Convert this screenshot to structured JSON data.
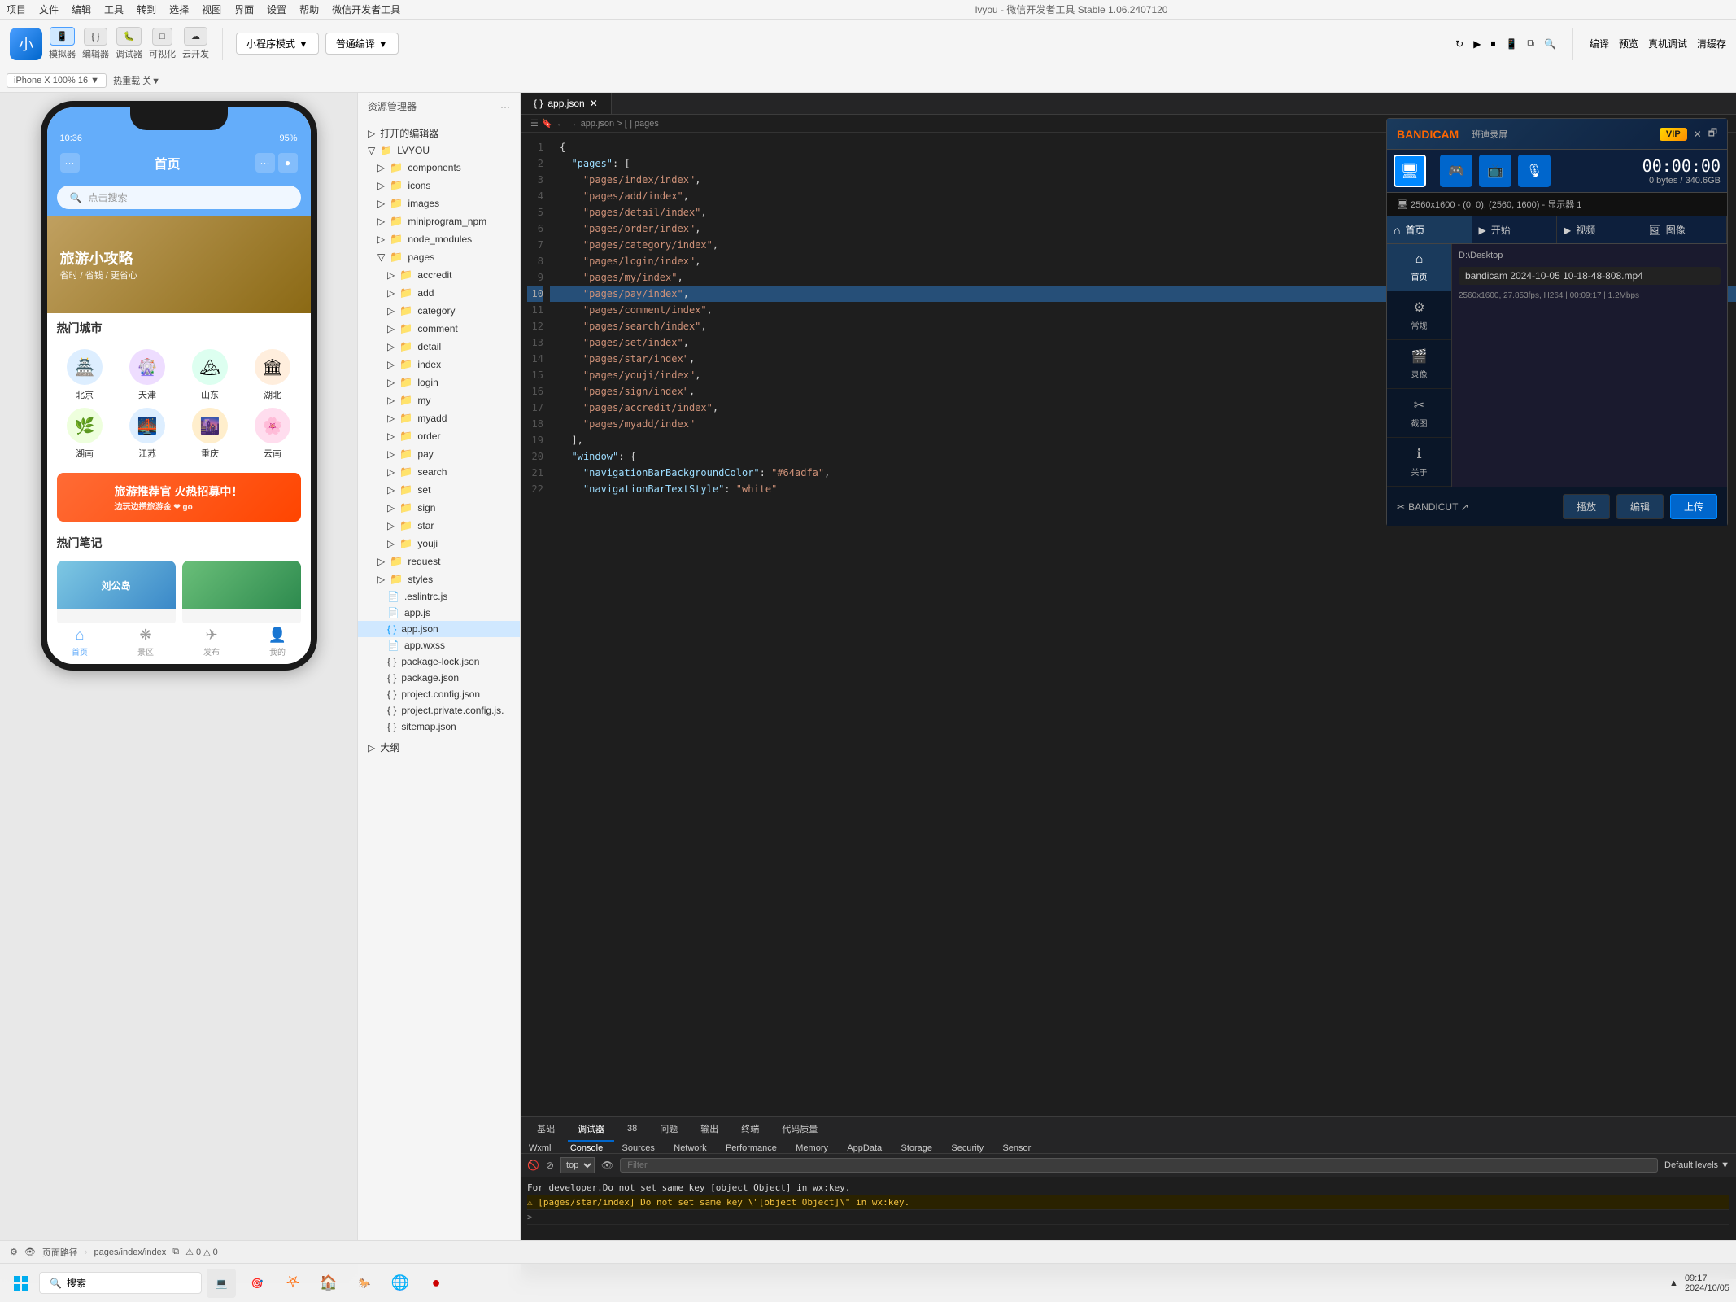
{
  "app": {
    "title": "lvyou - 微信开发者工具 Stable 1.06.2407120"
  },
  "menu": {
    "items": [
      "项目",
      "文件",
      "编辑",
      "工具",
      "转到",
      "选择",
      "视图",
      "界面",
      "设置",
      "帮助",
      "微信开发者工具"
    ]
  },
  "toolbar": {
    "simulator_label": "模拟器",
    "editor_label": "编辑器",
    "debugger_label": "调试器",
    "visual_label": "可视化",
    "cloud_label": "云开发",
    "mode_label": "小程序模式",
    "compile_label": "普通编译",
    "translate_label": "编译",
    "preview_label": "预览",
    "real_label": "真机调试",
    "clear_label": "清缓存"
  },
  "secondary_toolbar": {
    "device": "iPhone X 100% 16 ▼",
    "reload": "热重载 关▼"
  },
  "phone": {
    "time": "10:36",
    "battery": "95%",
    "nav_title": "首页",
    "search_placeholder": "点击搜索",
    "banner_title": "旅游小攻略",
    "banner_subtitle": "省时 / 省钱 / 更省心",
    "hot_cities_title": "热门城市",
    "cities": [
      {
        "name": "北京",
        "icon": "🏯"
      },
      {
        "name": "天津",
        "icon": "🎡"
      },
      {
        "name": "山东",
        "icon": "🏔"
      },
      {
        "name": "湖北",
        "icon": "🏛"
      },
      {
        "name": "湖南",
        "icon": "🌿"
      },
      {
        "name": "江苏",
        "icon": "🌉"
      },
      {
        "name": "重庆",
        "icon": "🌆"
      },
      {
        "name": "云南",
        "icon": "🌸"
      }
    ],
    "promo_text": "旅游推荐官 火热招募中！",
    "promo_sub": "边玩边攒旅游金 ❤ go",
    "notes_title": "热门笔记",
    "notes": [
      {
        "title": "刘公岛",
        "color": "#5ba4d4"
      },
      {
        "title": "",
        "color": "#2d8a4e"
      }
    ],
    "bottom_nav": [
      {
        "label": "首页",
        "icon": "⌂",
        "active": true
      },
      {
        "label": "景区",
        "icon": "❋",
        "active": false
      },
      {
        "label": "发布",
        "icon": "✈",
        "active": false
      },
      {
        "label": "我的",
        "icon": "👤",
        "active": false
      }
    ]
  },
  "file_explorer": {
    "title": "资源管理器",
    "section_open_editors": "打开的编辑器",
    "project_name": "LVYOU",
    "folders": [
      {
        "name": "components",
        "indent": 1
      },
      {
        "name": "icons",
        "indent": 1
      },
      {
        "name": "images",
        "indent": 1
      },
      {
        "name": "miniprogram_npm",
        "indent": 1
      },
      {
        "name": "node_modules",
        "indent": 1
      },
      {
        "name": "pages",
        "indent": 1
      },
      {
        "name": "accredit",
        "indent": 2
      },
      {
        "name": "add",
        "indent": 2
      },
      {
        "name": "category",
        "indent": 2
      },
      {
        "name": "comment",
        "indent": 2
      },
      {
        "name": "detail",
        "indent": 2
      },
      {
        "name": "index",
        "indent": 2
      },
      {
        "name": "login",
        "indent": 2
      },
      {
        "name": "my",
        "indent": 2
      },
      {
        "name": "myadd",
        "indent": 2
      },
      {
        "name": "order",
        "indent": 2
      },
      {
        "name": "pay",
        "indent": 2
      },
      {
        "name": "search",
        "indent": 2
      },
      {
        "name": "set",
        "indent": 2
      },
      {
        "name": "sign",
        "indent": 2
      },
      {
        "name": "star",
        "indent": 2
      },
      {
        "name": "youji",
        "indent": 2
      },
      {
        "name": "request",
        "indent": 1
      },
      {
        "name": "styles",
        "indent": 1
      }
    ],
    "files": [
      {
        "name": ".eslintrc.js",
        "indent": 2
      },
      {
        "name": "app.js",
        "indent": 2
      },
      {
        "name": "app.json",
        "indent": 2,
        "active": true
      },
      {
        "name": "app.wxss",
        "indent": 2
      },
      {
        "name": "package-lock.json",
        "indent": 2
      },
      {
        "name": "package.json",
        "indent": 2
      },
      {
        "name": "project.config.json",
        "indent": 2
      },
      {
        "name": "project.private.config.js",
        "indent": 2
      },
      {
        "name": "sitemap.json",
        "indent": 2
      }
    ],
    "outline_label": "大纲"
  },
  "code_editor": {
    "tab_name": "app.json",
    "breadcrumb": "app.json > [ ] pages",
    "lines": [
      {
        "num": 1,
        "code": "{",
        "type": "normal"
      },
      {
        "num": 2,
        "code": "  \"pages\": [",
        "type": "normal"
      },
      {
        "num": 3,
        "code": "    \"pages/index/index\",",
        "type": "normal"
      },
      {
        "num": 4,
        "code": "    \"pages/add/index\",",
        "type": "normal"
      },
      {
        "num": 5,
        "code": "    \"pages/detail/index\",",
        "type": "normal"
      },
      {
        "num": 6,
        "code": "    \"pages/order/index\",",
        "type": "normal"
      },
      {
        "num": 7,
        "code": "    \"pages/category/index\",",
        "type": "normal"
      },
      {
        "num": 8,
        "code": "    \"pages/login/index\",",
        "type": "normal"
      },
      {
        "num": 9,
        "code": "    \"pages/my/index\",",
        "type": "normal"
      },
      {
        "num": 10,
        "code": "    \"pages/pay/index\",",
        "type": "highlighted"
      },
      {
        "num": 11,
        "code": "    \"pages/comment/index\",",
        "type": "normal"
      },
      {
        "num": 12,
        "code": "    \"pages/search/index\",",
        "type": "normal"
      },
      {
        "num": 13,
        "code": "    \"pages/set/index\",",
        "type": "normal"
      },
      {
        "num": 14,
        "code": "    \"pages/star/index\",",
        "type": "normal"
      },
      {
        "num": 15,
        "code": "    \"pages/youji/index\",",
        "type": "normal"
      },
      {
        "num": 16,
        "code": "    \"pages/sign/index\",",
        "type": "normal"
      },
      {
        "num": 17,
        "code": "    \"pages/accredit/index\",",
        "type": "normal"
      },
      {
        "num": 18,
        "code": "    \"pages/myadd/index\"",
        "type": "normal"
      },
      {
        "num": 19,
        "code": "  ],",
        "type": "normal"
      },
      {
        "num": 20,
        "code": "  \"window\": {",
        "type": "normal"
      },
      {
        "num": 21,
        "code": "    \"navigationBarBackgroundColor\": \"#64adfa\",",
        "type": "normal"
      },
      {
        "num": 22,
        "code": "    \"navigationBarTextStyle\": \"white\"",
        "type": "normal"
      }
    ]
  },
  "devtools": {
    "tabs": [
      "基础",
      "调试器",
      "38",
      "问题",
      "输出",
      "终端",
      "代码质量"
    ],
    "active_tab": "调试器",
    "sub_tabs": [
      "Wxml",
      "Console",
      "Sources",
      "Network",
      "Performance",
      "Memory",
      "AppData",
      "Storage",
      "Security",
      "Sensor"
    ],
    "active_sub_tab": "Console",
    "context": "top",
    "filter_placeholder": "Filter",
    "level": "Default levels ▼",
    "console_lines": [
      {
        "type": "normal",
        "text": "For developer.Do not set same key [object Object] in wx:key."
      },
      {
        "type": "warn",
        "text": "[pages/star/index] Do not set same key \\\"[object Object]\\\" in wx:key."
      },
      {
        "type": "prompt",
        "text": ">"
      }
    ]
  },
  "bandicam": {
    "logo": "BANDICAM",
    "subtitle": "班迪录屏",
    "vip_label": "VIP",
    "time": "00:00:00",
    "size": "0 bytes / 340.6GB",
    "resolution": "2560x1600 - (0, 0), (2560, 1600) - 显示器 1",
    "nav": [
      {
        "icon": "🖥",
        "label": "首页",
        "active": true
      },
      {
        "icon": "▶",
        "label": "视频",
        "active": false
      },
      {
        "icon": "🖼",
        "label": "图像",
        "active": false
      }
    ],
    "sidebar": [
      {
        "icon": "⌂",
        "label": "首页",
        "active": true
      },
      {
        "icon": "⚙",
        "label": "常规",
        "active": false
      },
      {
        "icon": "🎬",
        "label": "录像",
        "active": false
      },
      {
        "icon": "✂",
        "label": "截图",
        "active": false
      },
      {
        "icon": "ℹ",
        "label": "关于",
        "active": false
      }
    ],
    "path": "D:\\Desktop",
    "filename": "bandicam 2024-10-05 10-18-48-808.mp4",
    "video_info": "2560x1600, 27.853fps, H264 | 00:09:17 | 1.2Mbps",
    "buttons": {
      "play": "播放",
      "edit": "编辑",
      "upload": "上传",
      "bandicut": "BANDICUT ↗"
    }
  },
  "status_bar": {
    "path": "页面路径",
    "page": "pages/index/index"
  },
  "taskbar": {
    "search_text": "搜索",
    "time": "▲",
    "apps": [
      "🪟",
      "🔍",
      "💻",
      "🎯",
      "🎮",
      "🏠",
      "💻",
      "🦊",
      "⚙"
    ]
  }
}
